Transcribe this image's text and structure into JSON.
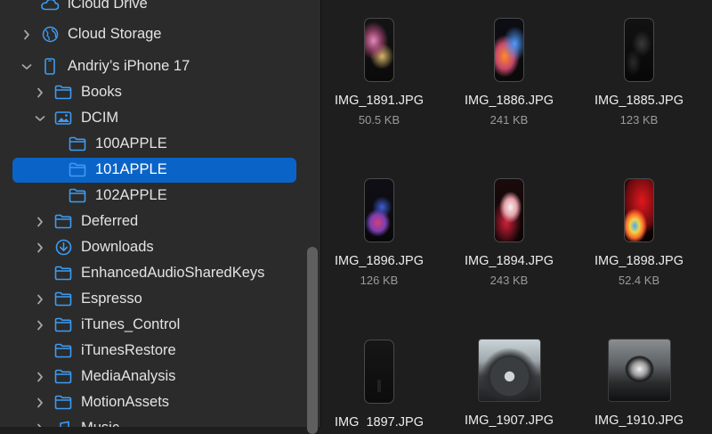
{
  "sidebar": {
    "items": [
      {
        "label": "iCloud Drive",
        "icon": "cloud-icon",
        "chevron": "none"
      },
      {
        "label": "Cloud Storage",
        "icon": "globe-icon",
        "chevron": "right"
      },
      {
        "label": "Andriy’s iPhone 17",
        "icon": "iphone-icon",
        "chevron": "down"
      },
      {
        "label": "Books",
        "icon": "folder-icon",
        "chevron": "right"
      },
      {
        "label": "DCIM",
        "icon": "photo-folder-icon",
        "chevron": "down"
      },
      {
        "label": "100APPLE",
        "icon": "folder-icon",
        "chevron": "none"
      },
      {
        "label": "101APPLE",
        "icon": "folder-icon",
        "chevron": "none",
        "selected": true
      },
      {
        "label": "102APPLE",
        "icon": "folder-icon",
        "chevron": "none"
      },
      {
        "label": "Deferred",
        "icon": "folder-icon",
        "chevron": "right"
      },
      {
        "label": "Downloads",
        "icon": "download-icon",
        "chevron": "right"
      },
      {
        "label": "EnhancedAudioSharedKeys",
        "icon": "folder-icon",
        "chevron": "none"
      },
      {
        "label": "Espresso",
        "icon": "folder-icon",
        "chevron": "right"
      },
      {
        "label": "iTunes_Control",
        "icon": "folder-icon",
        "chevron": "right"
      },
      {
        "label": "iTunesRestore",
        "icon": "folder-icon",
        "chevron": "none"
      },
      {
        "label": "MediaAnalysis",
        "icon": "folder-icon",
        "chevron": "right"
      },
      {
        "label": "MotionAssets",
        "icon": "folder-icon",
        "chevron": "right"
      },
      {
        "label": "Music",
        "icon": "music-icon",
        "chevron": "right"
      }
    ]
  },
  "files": [
    {
      "name": "IMG_1891.JPG",
      "size": "50.5 KB",
      "kind": "phone",
      "theme": "pink-swirl"
    },
    {
      "name": "IMG_1886.JPG",
      "size": "241 KB",
      "kind": "phone",
      "theme": "orange-blue"
    },
    {
      "name": "IMG_1885.JPG",
      "size": "123 KB",
      "kind": "phone",
      "theme": "dark-marble"
    },
    {
      "name": "IMG_1896.JPG",
      "size": "126 KB",
      "kind": "phone",
      "theme": "dark-wave"
    },
    {
      "name": "IMG_1894.JPG",
      "size": "243 KB",
      "kind": "phone",
      "theme": "red-white"
    },
    {
      "name": "IMG_1898.JPG",
      "size": "52.4 KB",
      "kind": "phone",
      "theme": "red-rainbow"
    },
    {
      "name": "IMG_1897.JPG",
      "size": "",
      "kind": "phone",
      "theme": "dark-blank"
    },
    {
      "name": "IMG_1907.JPG",
      "size": "",
      "kind": "photo",
      "theme": "steering-wheel"
    },
    {
      "name": "IMG_1910.JPG",
      "size": "",
      "kind": "photo",
      "theme": "cat-car"
    }
  ],
  "colors": {
    "selection": "#0a64c8",
    "icon_blue": "#3d9bf2",
    "sidebar_bg": "#2b2b2b",
    "content_bg": "#1e1e1e"
  }
}
